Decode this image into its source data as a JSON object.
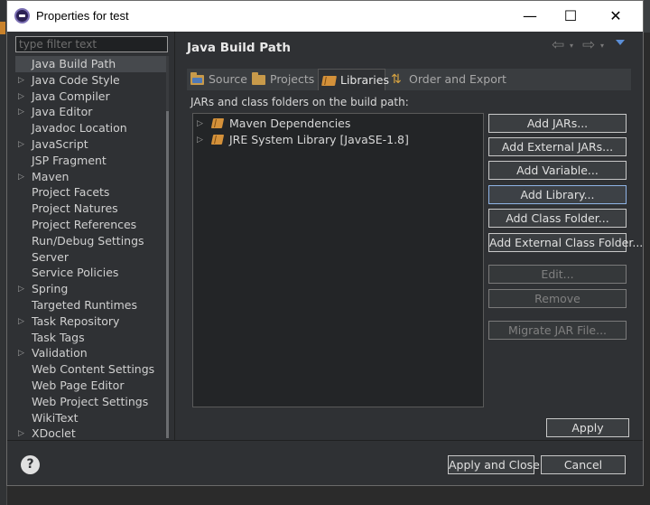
{
  "window": {
    "title": "Properties for test",
    "minimize_glyph": "—",
    "maximize_glyph": "☐",
    "close_glyph": "✕"
  },
  "filter": {
    "placeholder": "type filter text"
  },
  "tree": {
    "items": [
      {
        "label": "Java Build Path",
        "expandable": false,
        "selected": true
      },
      {
        "label": "Java Code Style",
        "expandable": true
      },
      {
        "label": "Java Compiler",
        "expandable": true
      },
      {
        "label": "Java Editor",
        "expandable": true
      },
      {
        "label": "Javadoc Location",
        "expandable": false
      },
      {
        "label": "JavaScript",
        "expandable": true
      },
      {
        "label": "JSP Fragment",
        "expandable": false
      },
      {
        "label": "Maven",
        "expandable": true
      },
      {
        "label": "Project Facets",
        "expandable": false
      },
      {
        "label": "Project Natures",
        "expandable": false
      },
      {
        "label": "Project References",
        "expandable": false
      },
      {
        "label": "Run/Debug Settings",
        "expandable": false
      },
      {
        "label": "Server",
        "expandable": false
      },
      {
        "label": "Service Policies",
        "expandable": false
      },
      {
        "label": "Spring",
        "expandable": true
      },
      {
        "label": "Targeted Runtimes",
        "expandable": false
      },
      {
        "label": "Task Repository",
        "expandable": true
      },
      {
        "label": "Task Tags",
        "expandable": false
      },
      {
        "label": "Validation",
        "expandable": true
      },
      {
        "label": "Web Content Settings",
        "expandable": false
      },
      {
        "label": "Web Page Editor",
        "expandable": false
      },
      {
        "label": "Web Project Settings",
        "expandable": false
      },
      {
        "label": "WikiText",
        "expandable": false
      },
      {
        "label": "XDoclet",
        "expandable": true
      }
    ]
  },
  "page": {
    "title": "Java Build Path",
    "nav": {
      "back": "⇦",
      "forward": "⇨",
      "dropdown": "▾"
    },
    "tabs": [
      {
        "label": "Source",
        "icon": "source-folder-icon"
      },
      {
        "label": "Projects",
        "icon": "projects-folder-icon"
      },
      {
        "label": "Libraries",
        "icon": "library-book-icon",
        "active": true
      },
      {
        "label": "Order and Export",
        "icon": "order-arrows-icon"
      }
    ],
    "description": "JARs and class folders on the build path:",
    "libraries": [
      {
        "label": "Maven Dependencies"
      },
      {
        "label": "JRE System Library [JavaSE-1.8]"
      }
    ],
    "buttons": {
      "add_jars": "Add JARs...",
      "add_external_jars": "Add External JARs...",
      "add_variable": "Add Variable...",
      "add_library": "Add Library...",
      "add_class_folder": "Add Class Folder...",
      "add_external_class_folder": "Add External Class Folder...",
      "edit": "Edit...",
      "remove": "Remove",
      "migrate_jar": "Migrate JAR File...",
      "apply": "Apply"
    }
  },
  "footer": {
    "help": "?",
    "apply_and_close": "Apply and Close",
    "cancel": "Cancel"
  },
  "colors": {
    "dialog_bg": "#2f3134",
    "accent_focus": "#8fb4e6",
    "library_icon": "#d4913a"
  }
}
